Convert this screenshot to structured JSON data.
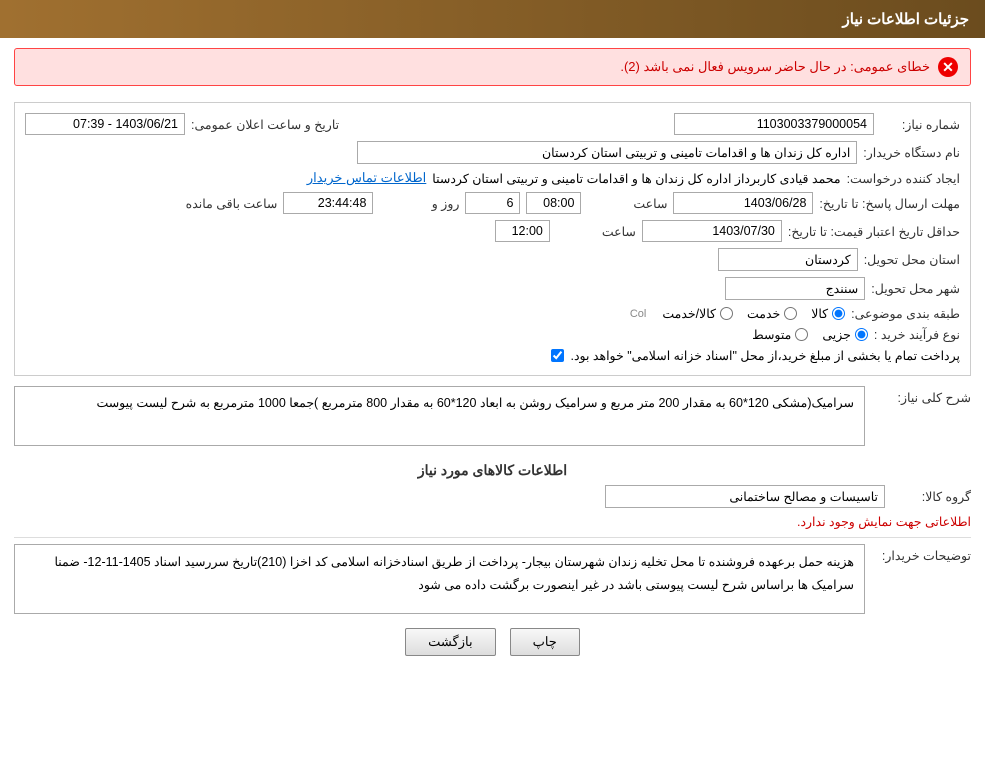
{
  "header": {
    "title": "جزئیات اطلاعات نیاز"
  },
  "error": {
    "message": "خطای عمومی: در حال حاضر سرویس فعال نمی باشد (2)."
  },
  "form": {
    "shomareNiaz_label": "شماره نیاز:",
    "shomareNiaz_value": "1103003379000054",
    "namDastgah_label": "نام دستگاه خریدار:",
    "namDastgah_value": "اداره کل زندان ها و اقدامات تامینی و تربیتی استان کردستان",
    "tarikh_label": "تاریخ و ساعت اعلان عمومی:",
    "tarikh_value": "1403/06/21 - 07:39",
    "ijadKonande_label": "ایجاد کننده درخواست:",
    "ijadKonande_value": "محمد  قیادی کاربرداز اداره کل زندان ها و اقدامات تامینی و تربیتی استان کردستا",
    "ijadKonande_link": "اطلاعات تماس خریدار",
    "mohlat_label": "مهلت ارسال پاسخ: تا تاریخ:",
    "mohlat_date": "1403/06/28",
    "mohlat_time": "08:00",
    "mohlat_roz": "6",
    "mohlat_remaining": "23:44:48",
    "mohlat_remaining_label": "ساعت باقی مانده",
    "roz_label": "روز و",
    "saat_label": "ساعت",
    "hadaqal_label": "حداقل تاریخ اعتبار قیمت: تا تاریخ:",
    "hadaqal_date": "1403/07/30",
    "hadaqal_time": "12:00",
    "ostan_label": "استان محل تحویل:",
    "ostan_value": "کردستان",
    "shahr_label": "شهر محل تحویل:",
    "shahr_value": "سنندج",
    "tabaqe_label": "طبقه بندی موضوعی:",
    "tabaqe_options": [
      {
        "label": "کالا",
        "value": "kala"
      },
      {
        "label": "خدمت",
        "value": "khedmat"
      },
      {
        "label": "کالا/خدمت",
        "value": "kala_khedmat"
      }
    ],
    "tabaqe_selected": "kala",
    "navFarayand_label": "نوع فرآیند خرید :",
    "navFarayand_options": [
      {
        "label": "جزیی",
        "value": "jozii"
      },
      {
        "label": "متوسط",
        "value": "motavaset"
      }
    ],
    "navFarayand_selected": "jozii",
    "checkbox_label": "پرداخت تمام یا بخشی از مبلغ خرید،از محل \"اسناد خزانه اسلامی\" خواهد بود.",
    "checkbox_checked": true,
    "sharhKoli_label": "شرح کلی نیاز:",
    "sharhKoli_value": "سرامیک(مشکی  120*60  به مقدار 200 متر مربع  و  سرامیک روشن به ابعاد 120*60 به مقدار 800 مترمربع\r\n)جمعا 1000 مترمربع به شرح لیست پیوست",
    "kalaha_title": "اطلاعات کالاهای مورد نیاز",
    "grohKala_label": "گروه کالا:",
    "grohKala_value": "تاسیسات و مصالح ساختمانی",
    "noInfo_text": "اطلاعاتی جهت نمایش وجود ندارد.",
    "tawzih_label": "توضیحات خریدار:",
    "tawzih_value": "هزینه حمل برعهده فروشنده  تا محل  تخلیه  زندان  شهرستان بیجار- پرداخت از طریق اسنادخزانه اسلامی کد اخزا\n(210)تاریخ سررسید اسناد 1405-11-12- ضمنا سرامیک ها براساس شرح لیست پیوستی باشد در غیر اینصورت برگشت\nداده می شود",
    "btn_print": "چاپ",
    "btn_back": "بازگشت"
  }
}
